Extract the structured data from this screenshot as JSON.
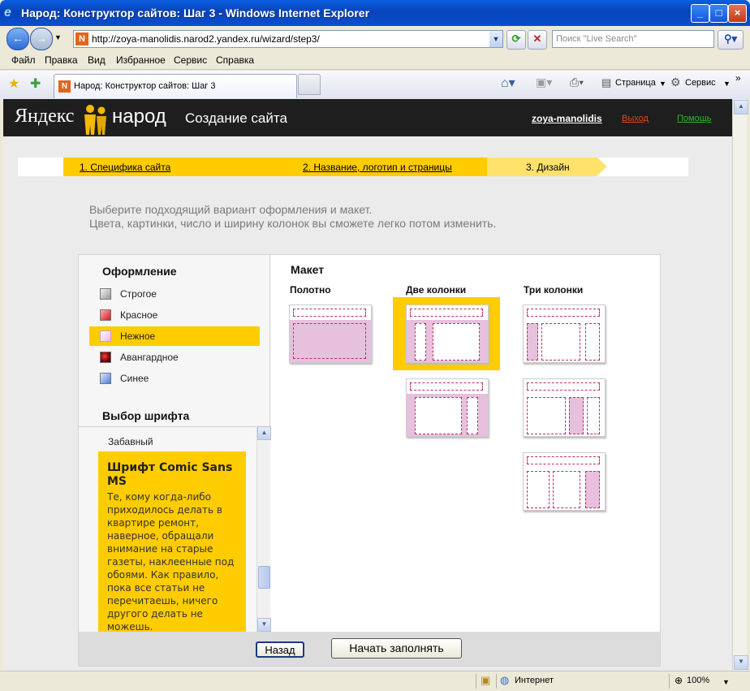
{
  "window": {
    "title": "Народ: Конструктор сайтов: Шаг 3 - Windows Internet Explorer"
  },
  "address": {
    "url": "http://zoya-manolidis.narod2.yandex.ru/wizard/step3/",
    "search_placeholder": "Поиск \"Live Search\""
  },
  "menu": [
    "Файл",
    "Правка",
    "Вид",
    "Избранное",
    "Сервис",
    "Справка"
  ],
  "tab": {
    "label": "Народ: Конструктор сайтов: Шаг 3"
  },
  "toolbar": {
    "page_label": "Страница",
    "tools_label": "Сервис"
  },
  "header": {
    "logo_yandex": "Яндекс",
    "logo_narod": "народ",
    "page_title": "Создание сайта",
    "username": "zoya-manolidis",
    "logout": "Выход",
    "help": "Помощь"
  },
  "steps": [
    "1. Специфика сайта",
    "2. Название, логотип и страницы",
    "3. Дизайн"
  ],
  "intro": {
    "line1": "Выберите подходящий вариант оформления и макет.",
    "line2": "Цвета, картинки, число и ширину колонок вы сможете легко потом изменить."
  },
  "design": {
    "heading": "Оформление",
    "themes": [
      {
        "label": "Строгое",
        "color": "#bdbdbd"
      },
      {
        "label": "Красное",
        "color": "#e8323b"
      },
      {
        "label": "Нежное",
        "color": "#f4c6e4"
      },
      {
        "label": "Авангардное",
        "color": "#c8141e"
      },
      {
        "label": "Синее",
        "color": "#6a9be8"
      }
    ],
    "selected_theme": "Нежное"
  },
  "font": {
    "heading": "Выбор шрифта",
    "item": "Забавный",
    "title": "Шрифт Comic Sans MS",
    "description": "Те, кому когда-либо приходилось делать в квартире ремонт, наверное, обращали внимание на старые газеты, наклеенные под обоями. Как правило, пока все статьи не перечитаешь, ничего другого делать не можешь."
  },
  "layout": {
    "heading": "Макет",
    "groups": [
      "Полотно",
      "Две колонки",
      "Три колонки"
    ],
    "selected": "Две колонки"
  },
  "buttons": {
    "back": "Назад",
    "start": "Начать заполнять"
  },
  "status": {
    "zone": "Интернет",
    "zoom": "100%"
  },
  "colors": {
    "accent": "#ffcc00",
    "header_bg": "#1e1e1e",
    "pink": "#e6c0dc",
    "dash": "#b9306b"
  }
}
